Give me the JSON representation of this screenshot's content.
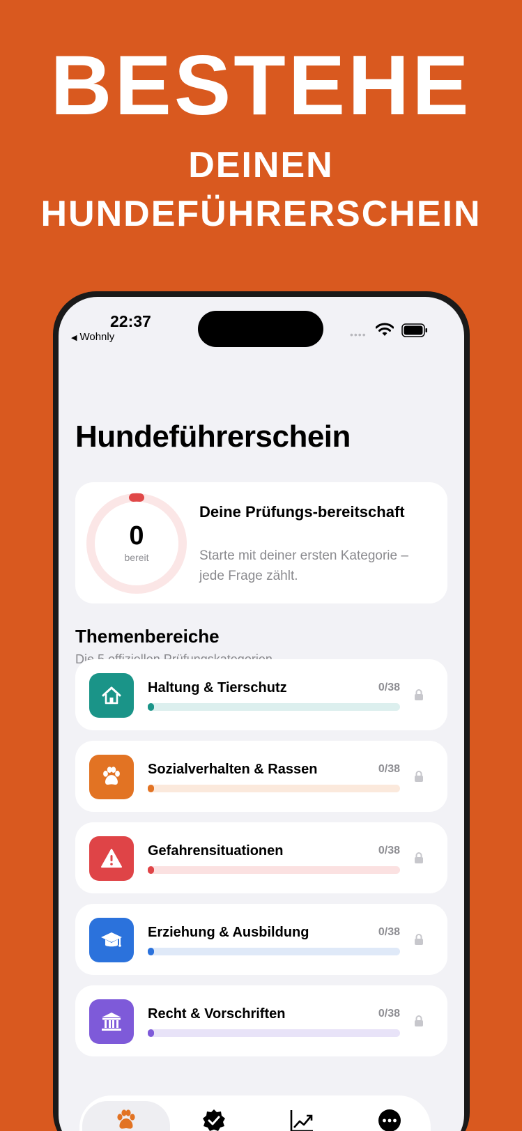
{
  "promo": {
    "line1": "BESTEHE",
    "line2": "DEINEN",
    "line3": "HUNDEFÜHRERSCHEIN",
    "background": "#d9591f"
  },
  "status_bar": {
    "time": "22:37",
    "back_app": "Wohnly",
    "signal": "••••"
  },
  "page": {
    "title": "Hundeführerschein"
  },
  "readiness": {
    "value": "0",
    "label": "bereit",
    "progress": 0,
    "title": "Deine Prüfungs-bereitschaft",
    "subtitle": "Starte mit deiner ersten Kategorie – jede Frage zählt.",
    "ring_color": "#e04848"
  },
  "section": {
    "title": "Themenbereiche",
    "subtitle": "Die 5 offiziellen Prüfungskategorien"
  },
  "categories": [
    {
      "name": "Haltung & Tierschutz",
      "count": "0/38",
      "progress": 0,
      "icon": "house-icon",
      "color": "#1a9488",
      "track": "#dcefee"
    },
    {
      "name": "Sozialverhalten & Rassen",
      "count": "0/38",
      "progress": 0,
      "icon": "paw-icon",
      "color": "#e27323",
      "track": "#fbe9dc"
    },
    {
      "name": "Gefahrensituationen",
      "count": "0/38",
      "progress": 0,
      "icon": "warning-icon",
      "color": "#df4447",
      "track": "#fbe1e1"
    },
    {
      "name": "Erziehung & Ausbildung",
      "count": "0/38",
      "progress": 0,
      "icon": "graduation-cap-icon",
      "color": "#2b72dc",
      "track": "#dfe9f8"
    },
    {
      "name": "Recht & Vorschriften",
      "count": "0/38",
      "progress": 0,
      "icon": "courthouse-icon",
      "color": "#7e5ad9",
      "track": "#e8e3f8"
    }
  ],
  "tabs": [
    {
      "icon": "paw-icon",
      "active": true
    },
    {
      "icon": "check-badge-icon",
      "active": false
    },
    {
      "icon": "chart-icon",
      "active": false
    },
    {
      "icon": "more-icon",
      "active": false
    }
  ]
}
